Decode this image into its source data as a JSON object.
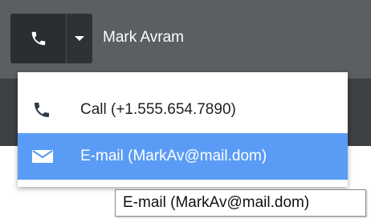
{
  "toolbar": {
    "contact_name": "Mark Avram",
    "call_icon": "phone-icon",
    "dropdown_icon": "caret-down-icon"
  },
  "menu": {
    "items": [
      {
        "label": "Call (+1.555.654.7890)",
        "icon": "phone-icon"
      },
      {
        "label": "E-mail (MarkAv@mail.dom)",
        "icon": "envelope-icon",
        "highlighted": true
      }
    ]
  },
  "tooltip": {
    "text": "E-mail (MarkAv@mail.dom)"
  },
  "colors": {
    "toolbar": "#5b5e62",
    "button": "#2a2d31",
    "highlight": "#5a9cf5",
    "phone_icon_menu": "#2f3a44"
  }
}
